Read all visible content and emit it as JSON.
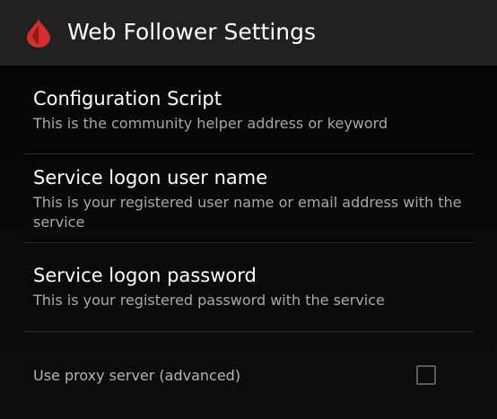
{
  "action_bar": {
    "app_icon": "droplet-icon",
    "title": "Web Follower Settings"
  },
  "preferences": [
    {
      "title": "Configuration Script",
      "summary": "This is the community helper address or keyword"
    },
    {
      "title": "Service logon user name",
      "summary": "This is your registered user name or email address with the service"
    },
    {
      "title": "Service logon password",
      "summary": "This is your registered password with the service"
    }
  ],
  "proxy": {
    "label": "Use proxy server (advanced)",
    "checked": false
  },
  "colors": {
    "action_bar_bg": "#212121",
    "accent_red": "#d32f2f",
    "background": "#000000"
  }
}
